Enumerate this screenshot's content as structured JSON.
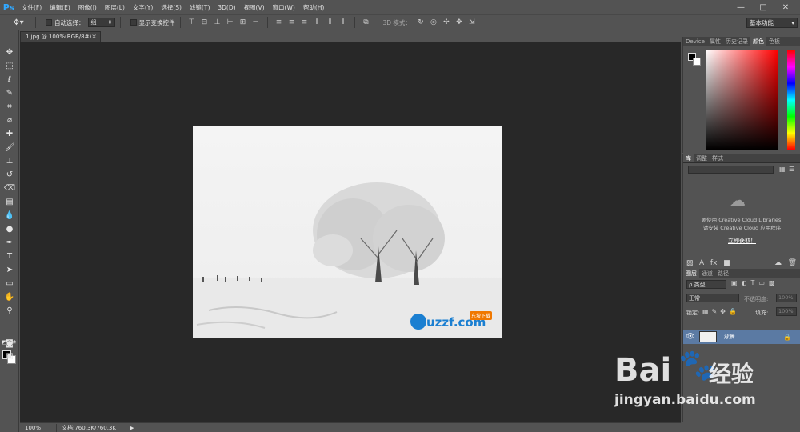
{
  "app": {
    "logo": "Ps"
  },
  "menu": [
    "文件(F)",
    "编辑(E)",
    "图像(I)",
    "图层(L)",
    "文字(Y)",
    "选择(S)",
    "滤镜(T)",
    "3D(D)",
    "视图(V)",
    "窗口(W)",
    "帮助(H)"
  ],
  "window_controls": {
    "minimize": "—",
    "maximize": "□",
    "close": "✕"
  },
  "options": {
    "auto_select_label": "自动选择：",
    "auto_select_value": "组",
    "show_transform_label": "显示变换控件",
    "mode_3d_label": "3D 模式：",
    "workspace": "基本功能"
  },
  "document": {
    "tab_title": "1.jpg @ 100%(RGB/8#)",
    "close": "×",
    "zoom": "100%",
    "doc_info": "文档:760.3K/760.3K"
  },
  "panels": {
    "color_tabs": [
      "Device",
      "属性",
      "历史记录",
      "颜色",
      "色板"
    ],
    "library_tabs": [
      "库",
      "调整",
      "样式"
    ],
    "library_msg1": "要使用 Creative Cloud Libraries,",
    "library_msg2": "请安装 Creative Cloud 应用程序",
    "library_link": "立即获取！",
    "layers_tabs": [
      "图层",
      "通道",
      "路径"
    ],
    "kind_label": "ρ 类型",
    "blend_mode": "正常",
    "opacity_label": "不透明度:",
    "opacity_value": "100%",
    "lock_label": "锁定:",
    "fill_label": "填充:",
    "fill_value": "100%",
    "layer_name": "背景"
  },
  "watermark": {
    "baidu": "Bai",
    "baidu_cn": "经验",
    "url": "jingyan.baidu.com",
    "uzzf": "uzzf.com",
    "uzzf_badge": "东坡下载"
  },
  "colors": {
    "ui_bg": "#535353",
    "canvas_bg": "#282828",
    "ps_blue": "#31a8ff",
    "layer_selected": "#5b7aa3"
  }
}
